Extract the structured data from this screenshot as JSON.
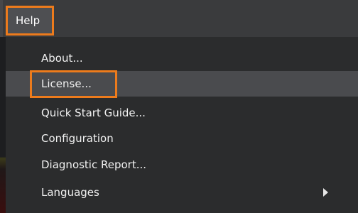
{
  "menubar": {
    "help_label": "Help"
  },
  "help_menu": {
    "items": [
      {
        "label": "About..."
      },
      {
        "label": "License..."
      },
      {
        "label": "Quick Start Guide..."
      },
      {
        "label": "Configuration"
      },
      {
        "label": "Diagnostic Report..."
      },
      {
        "label": "Languages"
      }
    ],
    "highlighted_item": "License..."
  },
  "colors": {
    "annotation_outline": "#ed7b1c",
    "menu_background": "#2b2c2d",
    "highlight_background": "#4a4b4e",
    "text": "#f2f2f2"
  }
}
